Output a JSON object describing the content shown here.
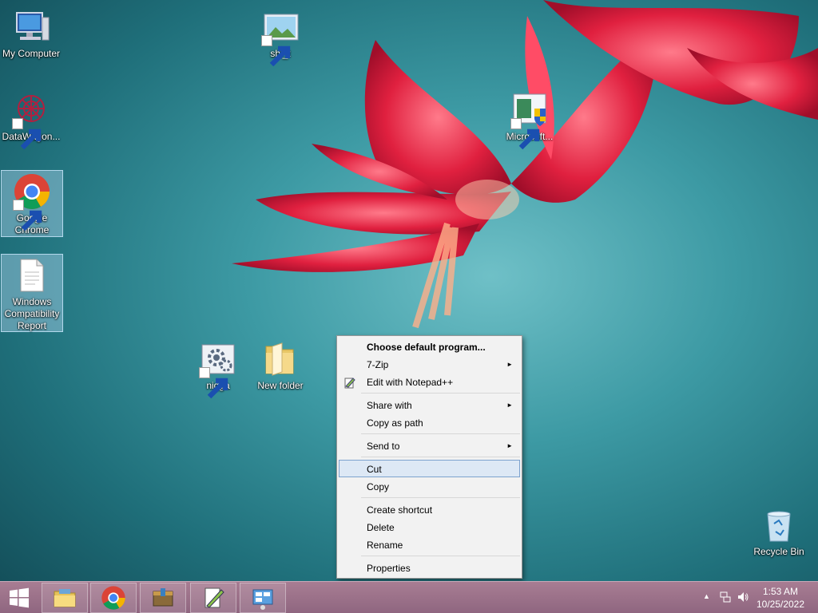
{
  "desktop": {
    "icons": [
      {
        "label": "My Computer"
      },
      {
        "label": "DataWagon..."
      },
      {
        "label": "Google Chrome"
      },
      {
        "label": "Windows Compatibility Report"
      },
      {
        "label": "shi_t"
      },
      {
        "label": "Microsoft..."
      },
      {
        "label": "nigga"
      },
      {
        "label": "New folder"
      },
      {
        "label": "Recycle Bin"
      }
    ]
  },
  "context_menu": {
    "items": [
      {
        "label": "Choose default program..."
      },
      {
        "label": "7-Zip"
      },
      {
        "label": "Edit with Notepad++"
      },
      {
        "label": "Share with"
      },
      {
        "label": "Copy as path"
      },
      {
        "label": "Send to"
      },
      {
        "label": "Cut"
      },
      {
        "label": "Copy"
      },
      {
        "label": "Create shortcut"
      },
      {
        "label": "Delete"
      },
      {
        "label": "Rename"
      },
      {
        "label": "Properties"
      }
    ],
    "submenu_arrow": "►"
  },
  "taskbar": {
    "clock_time": "1:53 AM",
    "clock_date": "10/25/2022",
    "tray_arrow": "▲"
  },
  "colors": {
    "accent_hover": "#dde8f5",
    "taskbar": "#9c7189"
  }
}
